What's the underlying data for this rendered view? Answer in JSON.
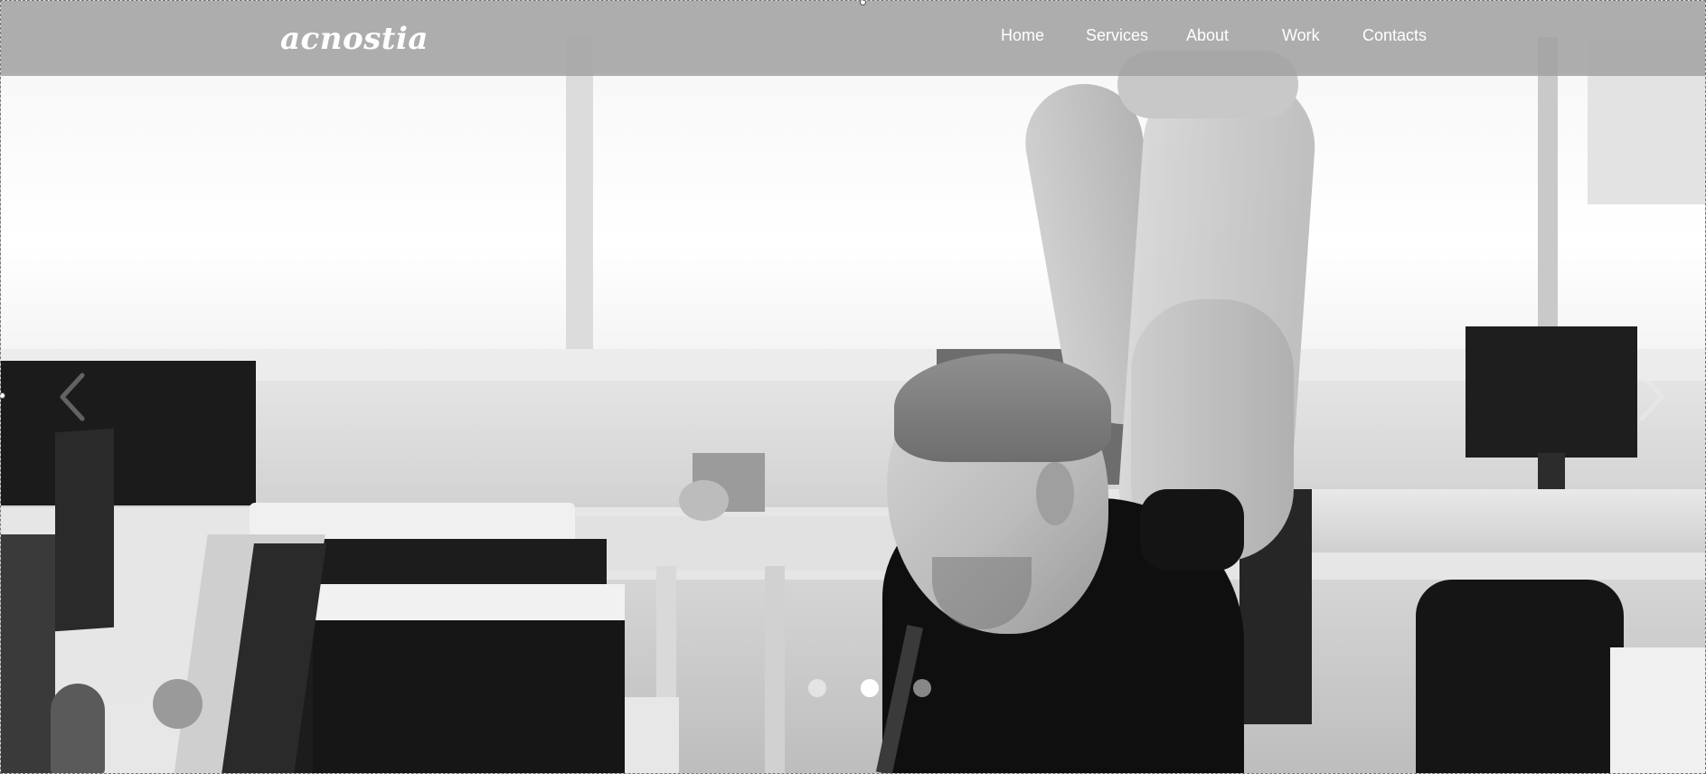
{
  "brand": {
    "logo_text": "acnostia"
  },
  "nav": {
    "items": [
      {
        "label": "Home"
      },
      {
        "label": "Services"
      },
      {
        "label": "About"
      },
      {
        "label": "Work"
      },
      {
        "label": "Contacts"
      }
    ]
  },
  "carousel": {
    "prev_icon": "chevron-left-icon",
    "next_icon": "chevron-right-icon",
    "slide_count": 3,
    "active_slide": 2
  },
  "colors": {
    "navbar_bg": "#a0a0a0",
    "nav_text": "#ffffff",
    "indicator_active": "#ffffff",
    "indicator_inactive": "#cfcfcf"
  }
}
